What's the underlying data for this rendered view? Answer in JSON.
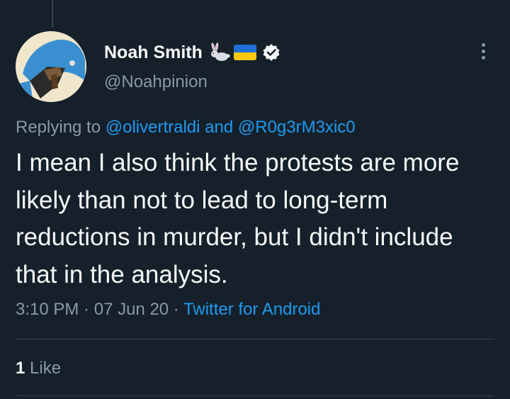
{
  "tweet": {
    "author": {
      "display_name": "Noah Smith",
      "handle": "@Noahpinion",
      "badges": [
        "rabbit-emoji",
        "ukraine-flag",
        "verified-badge"
      ]
    },
    "reply_context": {
      "prefix": "Replying to ",
      "mention_1": "@olivertraldi",
      "joiner": " and ",
      "mention_2": "@R0g3rM3xic0"
    },
    "text": "I mean I also think the protests are more likely than not to lead to long-term reductions in murder, but I didn't include that in the analysis.",
    "time": "3:10 PM",
    "separator": " · ",
    "date": "07 Jun 20",
    "source": "Twitter for Android",
    "likes": {
      "count": "1",
      "label": " Like"
    }
  },
  "colors": {
    "background": "#15202b",
    "text_primary": "#f7f9f9",
    "text_secondary": "#8b98a5",
    "accent": "#1d9bf0",
    "divider": "#38444d"
  }
}
